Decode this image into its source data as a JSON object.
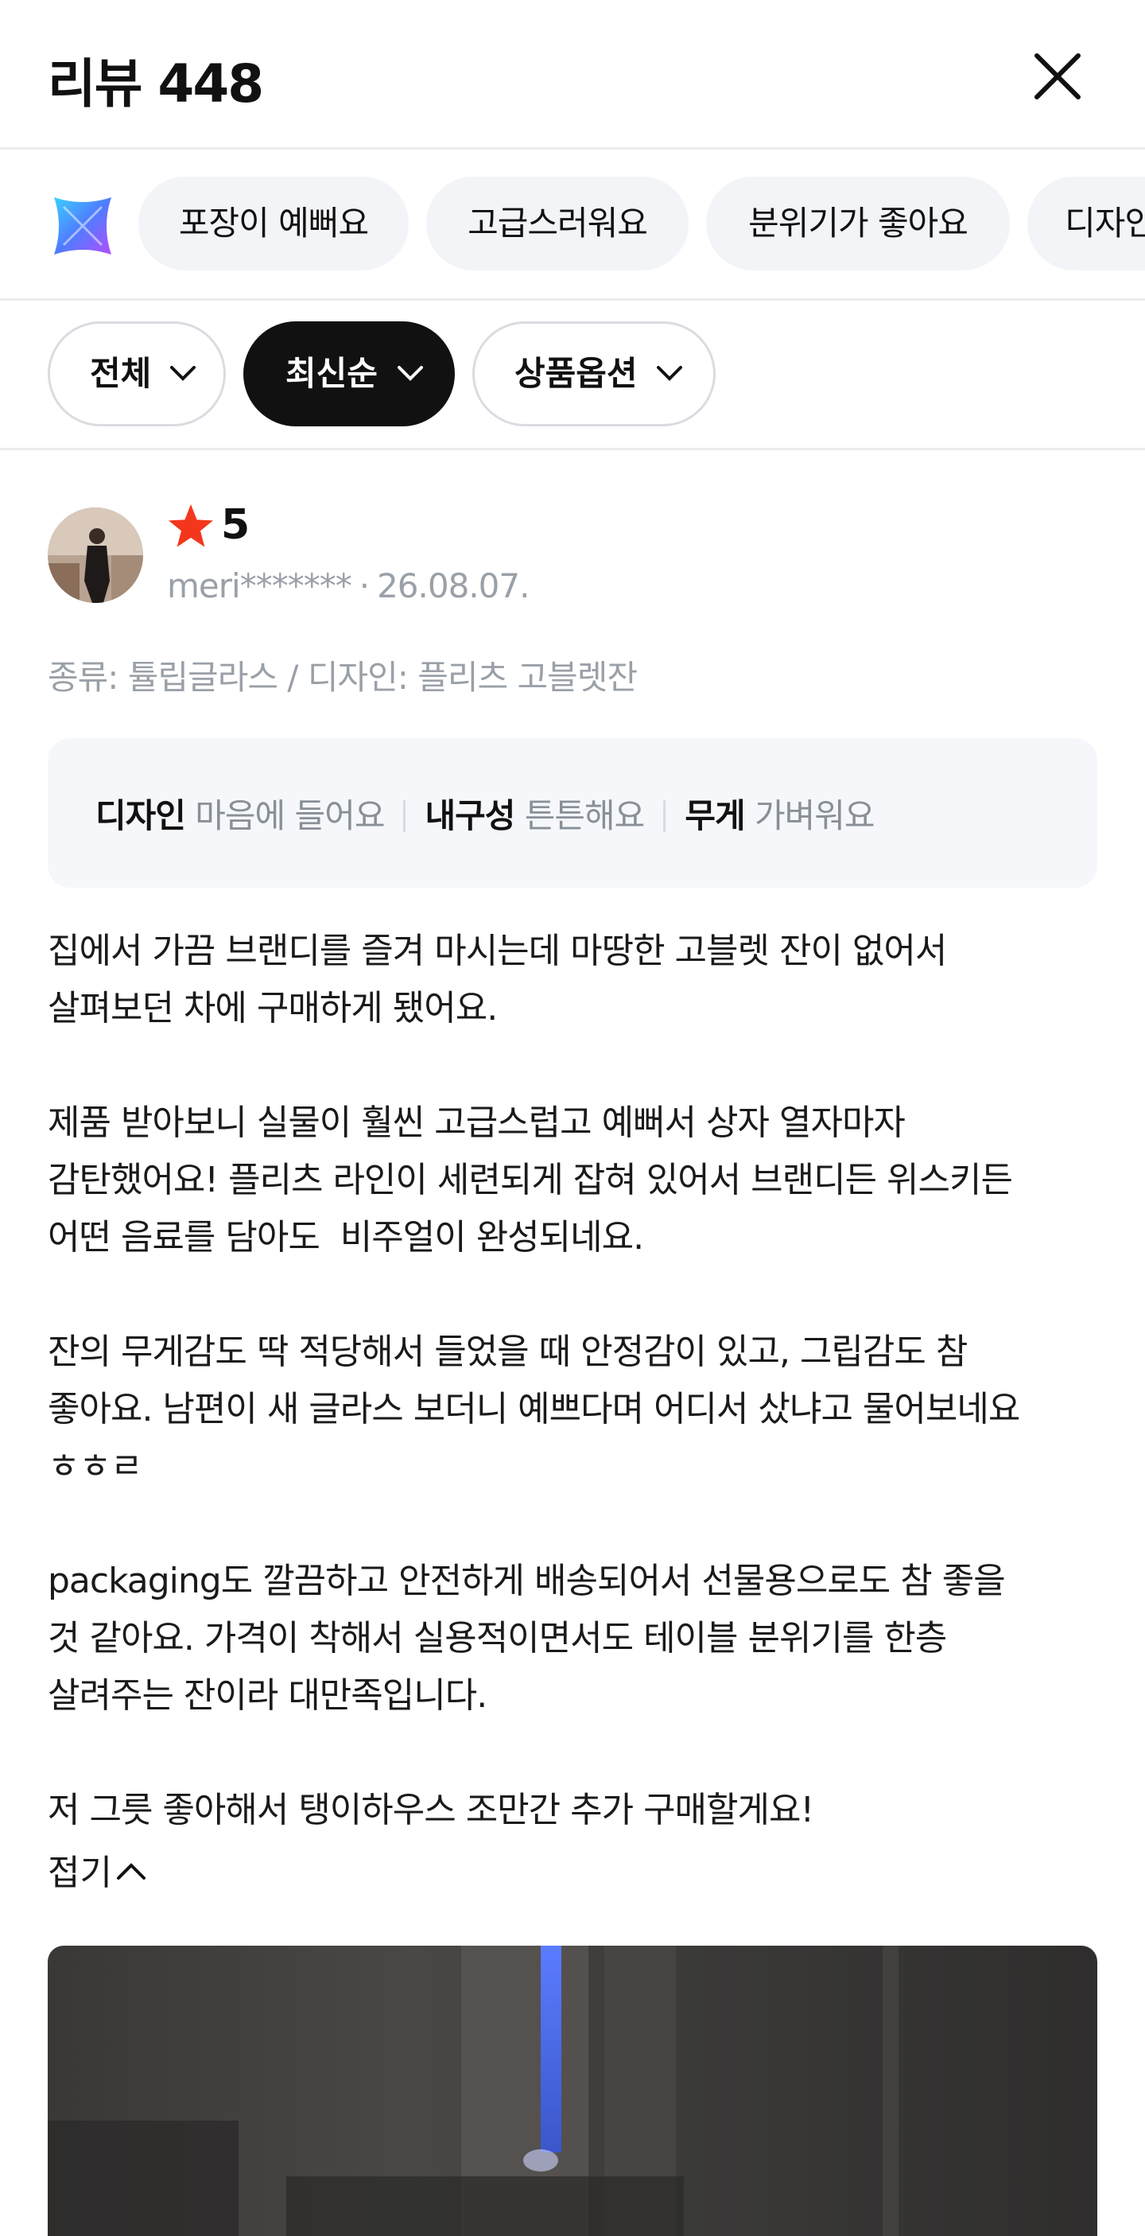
{
  "header": {
    "title": "리뷰 448"
  },
  "keyword_chips": [
    "포장이 예뻐요",
    "고급스러워요",
    "분위기가 좋아요",
    "디자인이 예뻐요"
  ],
  "filters": [
    {
      "label": "전체",
      "active": false
    },
    {
      "label": "최신순",
      "active": true
    },
    {
      "label": "상품옵션",
      "active": false
    }
  ],
  "review": {
    "rating": "5",
    "user": "meri*******",
    "date": "26.08.07.",
    "option": "종류: 튤립글라스 / 디자인: 플리츠 고블렛잔",
    "attributes": [
      {
        "name": "디자인",
        "value": "마음에 들어요"
      },
      {
        "name": "내구성",
        "value": "튼튼해요"
      },
      {
        "name": "무게",
        "value": "가벼워요"
      }
    ],
    "paragraphs": [
      "집에서 가끔 브랜디를 즐겨 마시는데 마땅한 고블렛 잔이 없어서\n살펴보던 차에 구매하게 됐어요.",
      "제품 받아보니 실물이 훨씬 고급스럽고 예뻐서 상자 열자마자\n감탄했어요! 플리츠 라인이 세련되게 잡혀 있어서 브랜디든 위스키든\n어떤 음료를 담아도  비주얼이 완성되네요.",
      "잔의 무게감도 딱 적당해서 들었을 때 안정감이 있고, 그립감도 참\n좋아요. 남편이 새 글라스 보더니 예쁘다며 어디서 샀냐고 물어보네요\nㅎㅎㄹ",
      "packaging도 깔끔하고 안전하게 배송되어서 선물용으로도 참 좋을\n것 같아요. 가격이 착해서 실용적이면서도 테이블 분위기를 한층\n살려주는 잔이라 대만족입니다.",
      "저 그릇 좋아해서 탱이하우스 조만간 추가 구매할게요!"
    ],
    "fold_label": "접기"
  },
  "colors": {
    "star": "#f4361c",
    "active_filter": "#111111",
    "chip_bg": "#f2f4f7"
  }
}
